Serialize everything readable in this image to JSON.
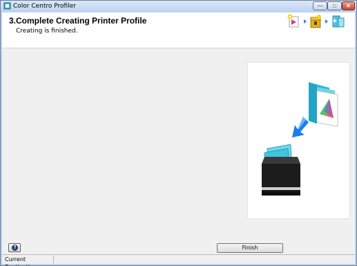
{
  "window": {
    "title": "Color Centro Profiler",
    "minimize_icon": "minimize-icon",
    "maximize_icon": "maximize-icon",
    "close_icon": "close-icon",
    "app_icon": "app-icon"
  },
  "header": {
    "step_title": "3.Complete Creating Printer Profile",
    "step_subtitle": "Creating is finished.",
    "wizard_icons": [
      "start-wizard-icon",
      "arrow-right-icon",
      "package-icon",
      "arrow-right-icon",
      "finish-flag-icon"
    ]
  },
  "illustration": {
    "icons": [
      "profile-folder-icon",
      "download-arrow-icon",
      "printer-tray-icon"
    ]
  },
  "footer": {
    "help_icon": "help-icon",
    "finish_label": "Finish"
  },
  "statusbar": {
    "panel_text": "Current Destination"
  },
  "colors": {
    "titlebar_top": "#dbe8f9",
    "titlebar_bottom": "#bed3ef",
    "client_bg": "#f0f0f0",
    "accent_blue": "#1a7ee8",
    "cyan": "#4fd1e6"
  }
}
